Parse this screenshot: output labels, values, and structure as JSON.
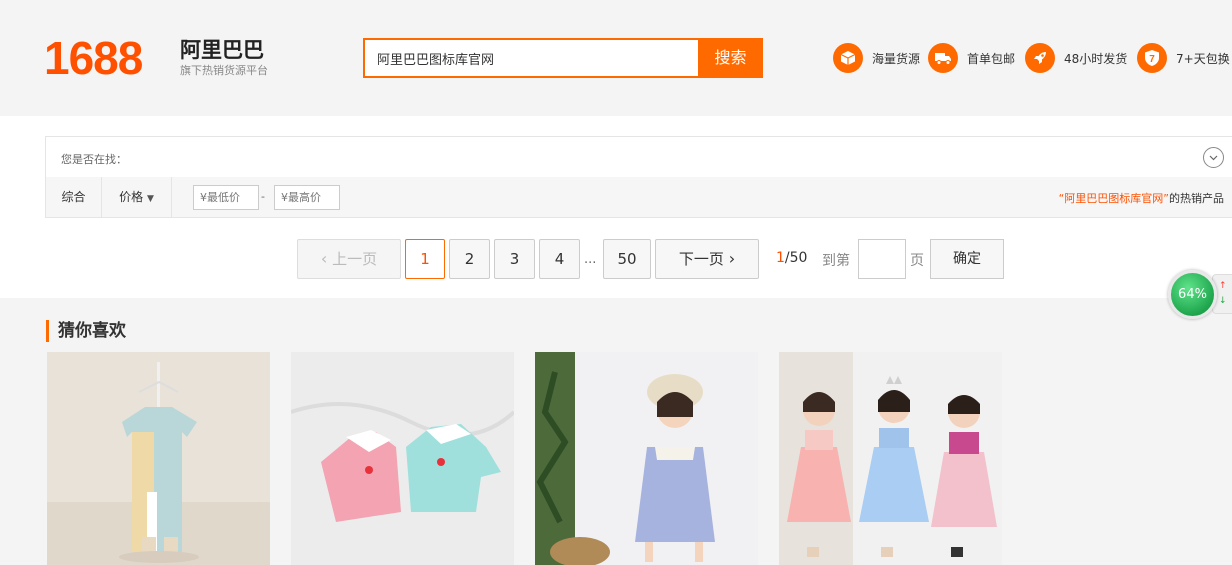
{
  "header": {
    "logo_number": "1688",
    "logo_name": "阿里巴巴",
    "logo_subtitle": "旗下热销货源平台",
    "search_value": "阿里巴巴图标库官网",
    "search_button": "搜索",
    "features": [
      {
        "icon": "box-icon",
        "label": "海量货源"
      },
      {
        "icon": "truck-icon",
        "label": "首单包邮"
      },
      {
        "icon": "rocket-icon",
        "label": "48小时发货"
      },
      {
        "icon": "shield-7-icon",
        "label": "7+天包换"
      }
    ]
  },
  "suggest": {
    "label": "您是否在找："
  },
  "filter": {
    "sort_default": "综合",
    "sort_price": "价格",
    "min_price_placeholder": "¥最低价",
    "max_price_placeholder": "¥最高价",
    "dash": "-",
    "hot_keyword": "“阿里巴巴图标库官网”",
    "hot_suffix": "的热销产品"
  },
  "pagination": {
    "prev": "上一页",
    "pages": [
      "1",
      "2",
      "3",
      "4"
    ],
    "ellipsis": "...",
    "last": "50",
    "next": "下一页",
    "current": "1",
    "total": "/50",
    "goto_label": "到第",
    "page_label": "页",
    "confirm": "确定"
  },
  "guess": {
    "title": "猜你喜欢"
  },
  "float_widget": {
    "percent": "64%"
  },
  "colors": {
    "brand": "#ff6a00",
    "brand_text": "#ff5000"
  }
}
